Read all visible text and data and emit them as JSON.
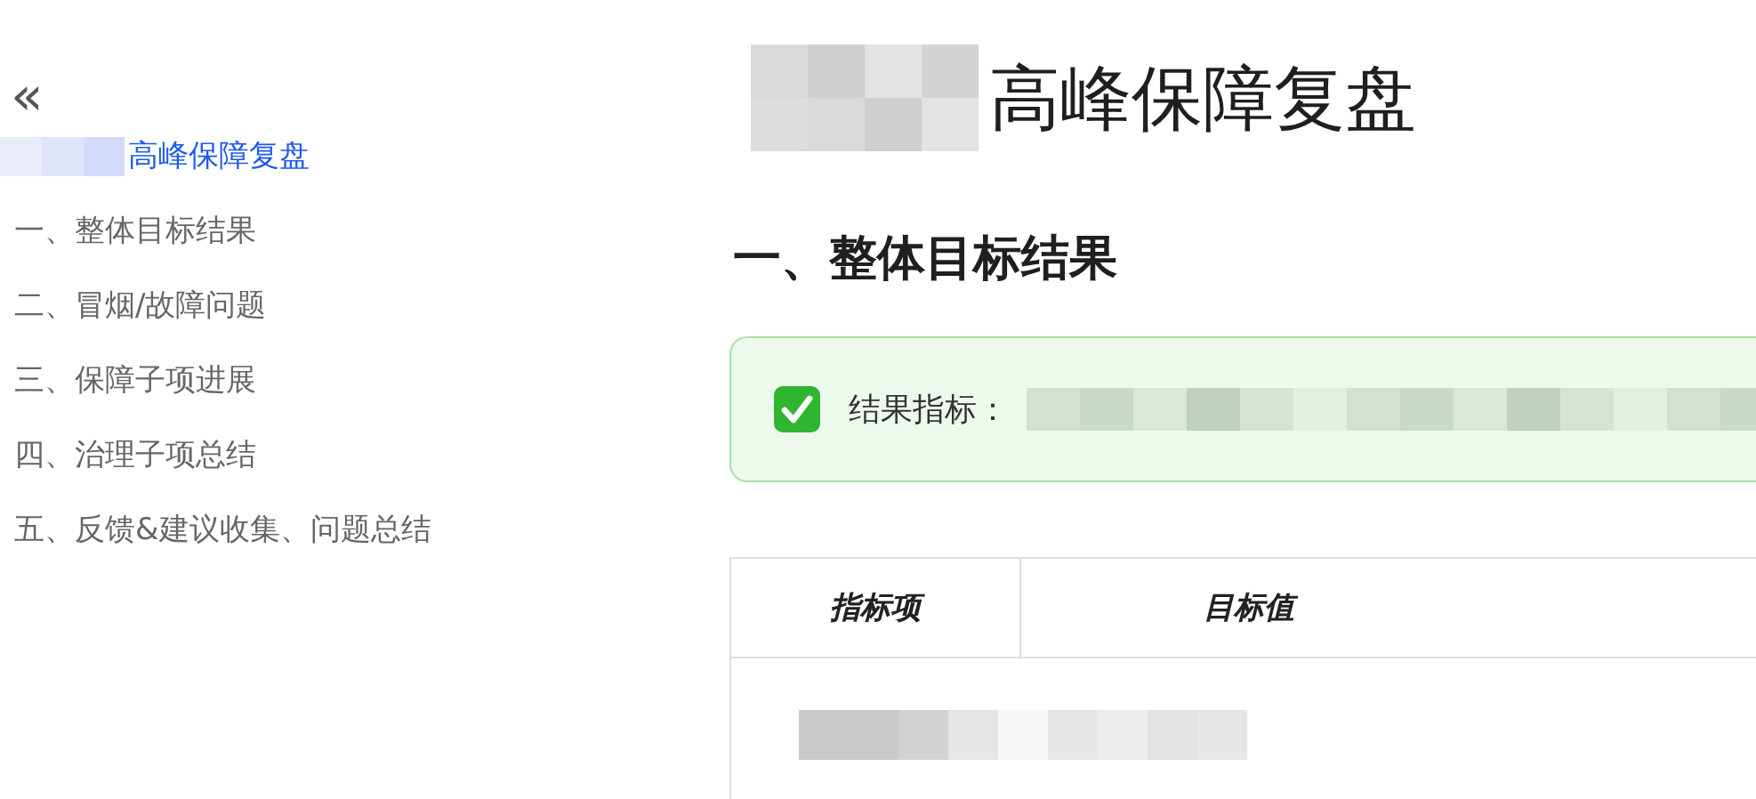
{
  "sidebar": {
    "collapse_icon": "«",
    "items": [
      {
        "label": "高峰保障复盘",
        "selected": true,
        "redacted_prefix": true
      },
      {
        "label": "一、整体目标结果",
        "selected": false
      },
      {
        "label": "二、冒烟/故障问题",
        "selected": false
      },
      {
        "label": "三、保障子项进展",
        "selected": false
      },
      {
        "label": "四、治理子项总结",
        "selected": false
      },
      {
        "label": "五、反馈&建议收集、问题总结",
        "selected": false
      }
    ]
  },
  "document": {
    "title": "高峰保障复盘",
    "heading": "一、整体目标结果",
    "callout": {
      "checked": true,
      "label": "结果指标："
    },
    "table": {
      "columns": [
        "指标项",
        "目标值"
      ]
    }
  }
}
